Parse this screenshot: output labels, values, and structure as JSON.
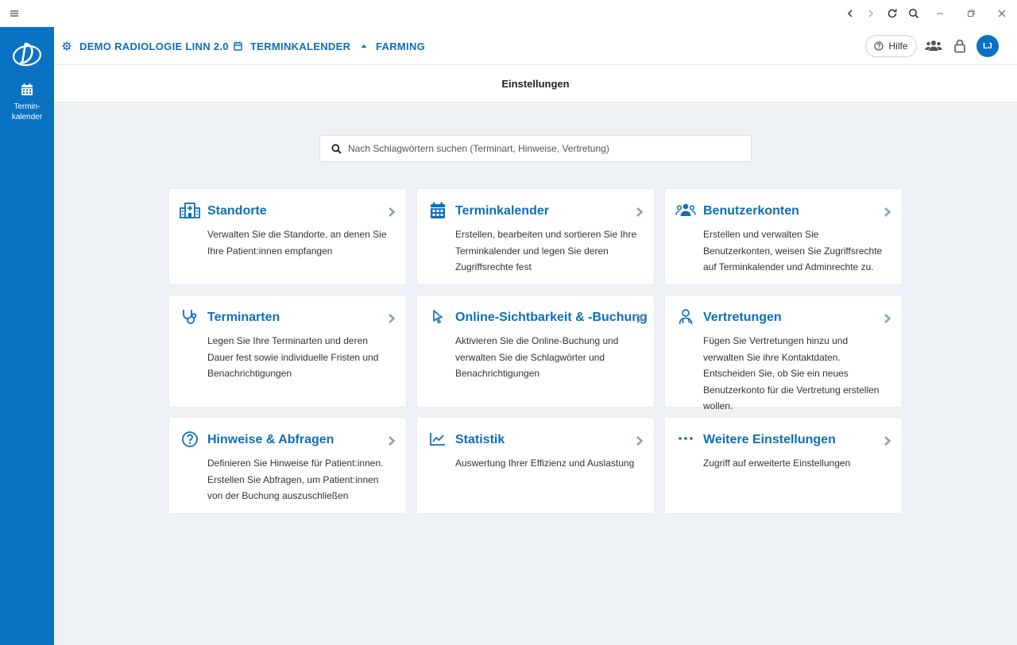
{
  "header": {
    "breadcrumbs": [
      {
        "label": "DEMO RADIOLOGIE LINN 2.0",
        "icon": "gear-icon"
      },
      {
        "label": "TERMINKALENDER",
        "icon": "calendar-icon"
      },
      {
        "label": "FARMING",
        "icon": "triangle-icon"
      }
    ],
    "help_label": "Hilfe",
    "avatar_initials": "LJ"
  },
  "sidebar": {
    "item_label_line1": "Termin-",
    "item_label_line2": "kalender"
  },
  "page_title": "Einstellungen",
  "search": {
    "placeholder": "Nach Schlagwörtern suchen (Terminart, Hinweise, Vertretung)"
  },
  "cards": [
    {
      "title": "Standorte",
      "desc": "Verwalten Sie die Standorte, an denen Sie Ihre Patient:innen empfangen",
      "icon": "building-icon"
    },
    {
      "title": "Terminkalender",
      "desc": "Erstellen, bearbeiten und sortieren Sie Ihre Terminkalender und legen Sie deren Zugriffsrechte fest",
      "icon": "calendar-icon"
    },
    {
      "title": "Benutzerkonten",
      "desc": "Erstellen und verwalten Sie Benutzerkonten, weisen Sie Zugriffsrechte auf Terminkalender und Adminrechte zu.",
      "icon": "users-icon"
    },
    {
      "title": "Terminarten",
      "desc": "Legen Sie Ihre Terminarten und deren Dauer fest sowie individuelle Fristen und Benachrichtigungen",
      "icon": "stethoscope-icon"
    },
    {
      "title": "Online-Sichtbarkeit & -Buchung",
      "desc": "Aktivieren Sie die Online-Buchung und verwalten Sie die Schlagwörter und Benachrichtigungen",
      "icon": "cursor-icon"
    },
    {
      "title": "Vertretungen",
      "desc": "Fügen Sie Vertretungen hinzu und verwalten Sie ihre Kontaktdaten. Entscheiden Sie, ob Sie ein neues Benutzerkonto für die Vertretung erstellen wollen.",
      "icon": "doctor-icon"
    },
    {
      "title": "Hinweise & Abfragen",
      "desc": "Definieren Sie Hinweise für Patient:innen. Erstellen Sie Abfragen, um Patient:innen von der Buchung auszuschließen",
      "icon": "question-icon"
    },
    {
      "title": "Statistik",
      "desc": "Auswertung Ihrer Effizienz und Auslastung",
      "icon": "chart-line-icon"
    },
    {
      "title": "Weitere Einstellungen",
      "desc": "Zugriff auf erweiterte Einstellungen",
      "icon": "more-dots-icon"
    }
  ],
  "colors": {
    "primary": "#0a72c2",
    "link": "#0d6fb8",
    "background": "#eef2f6"
  }
}
